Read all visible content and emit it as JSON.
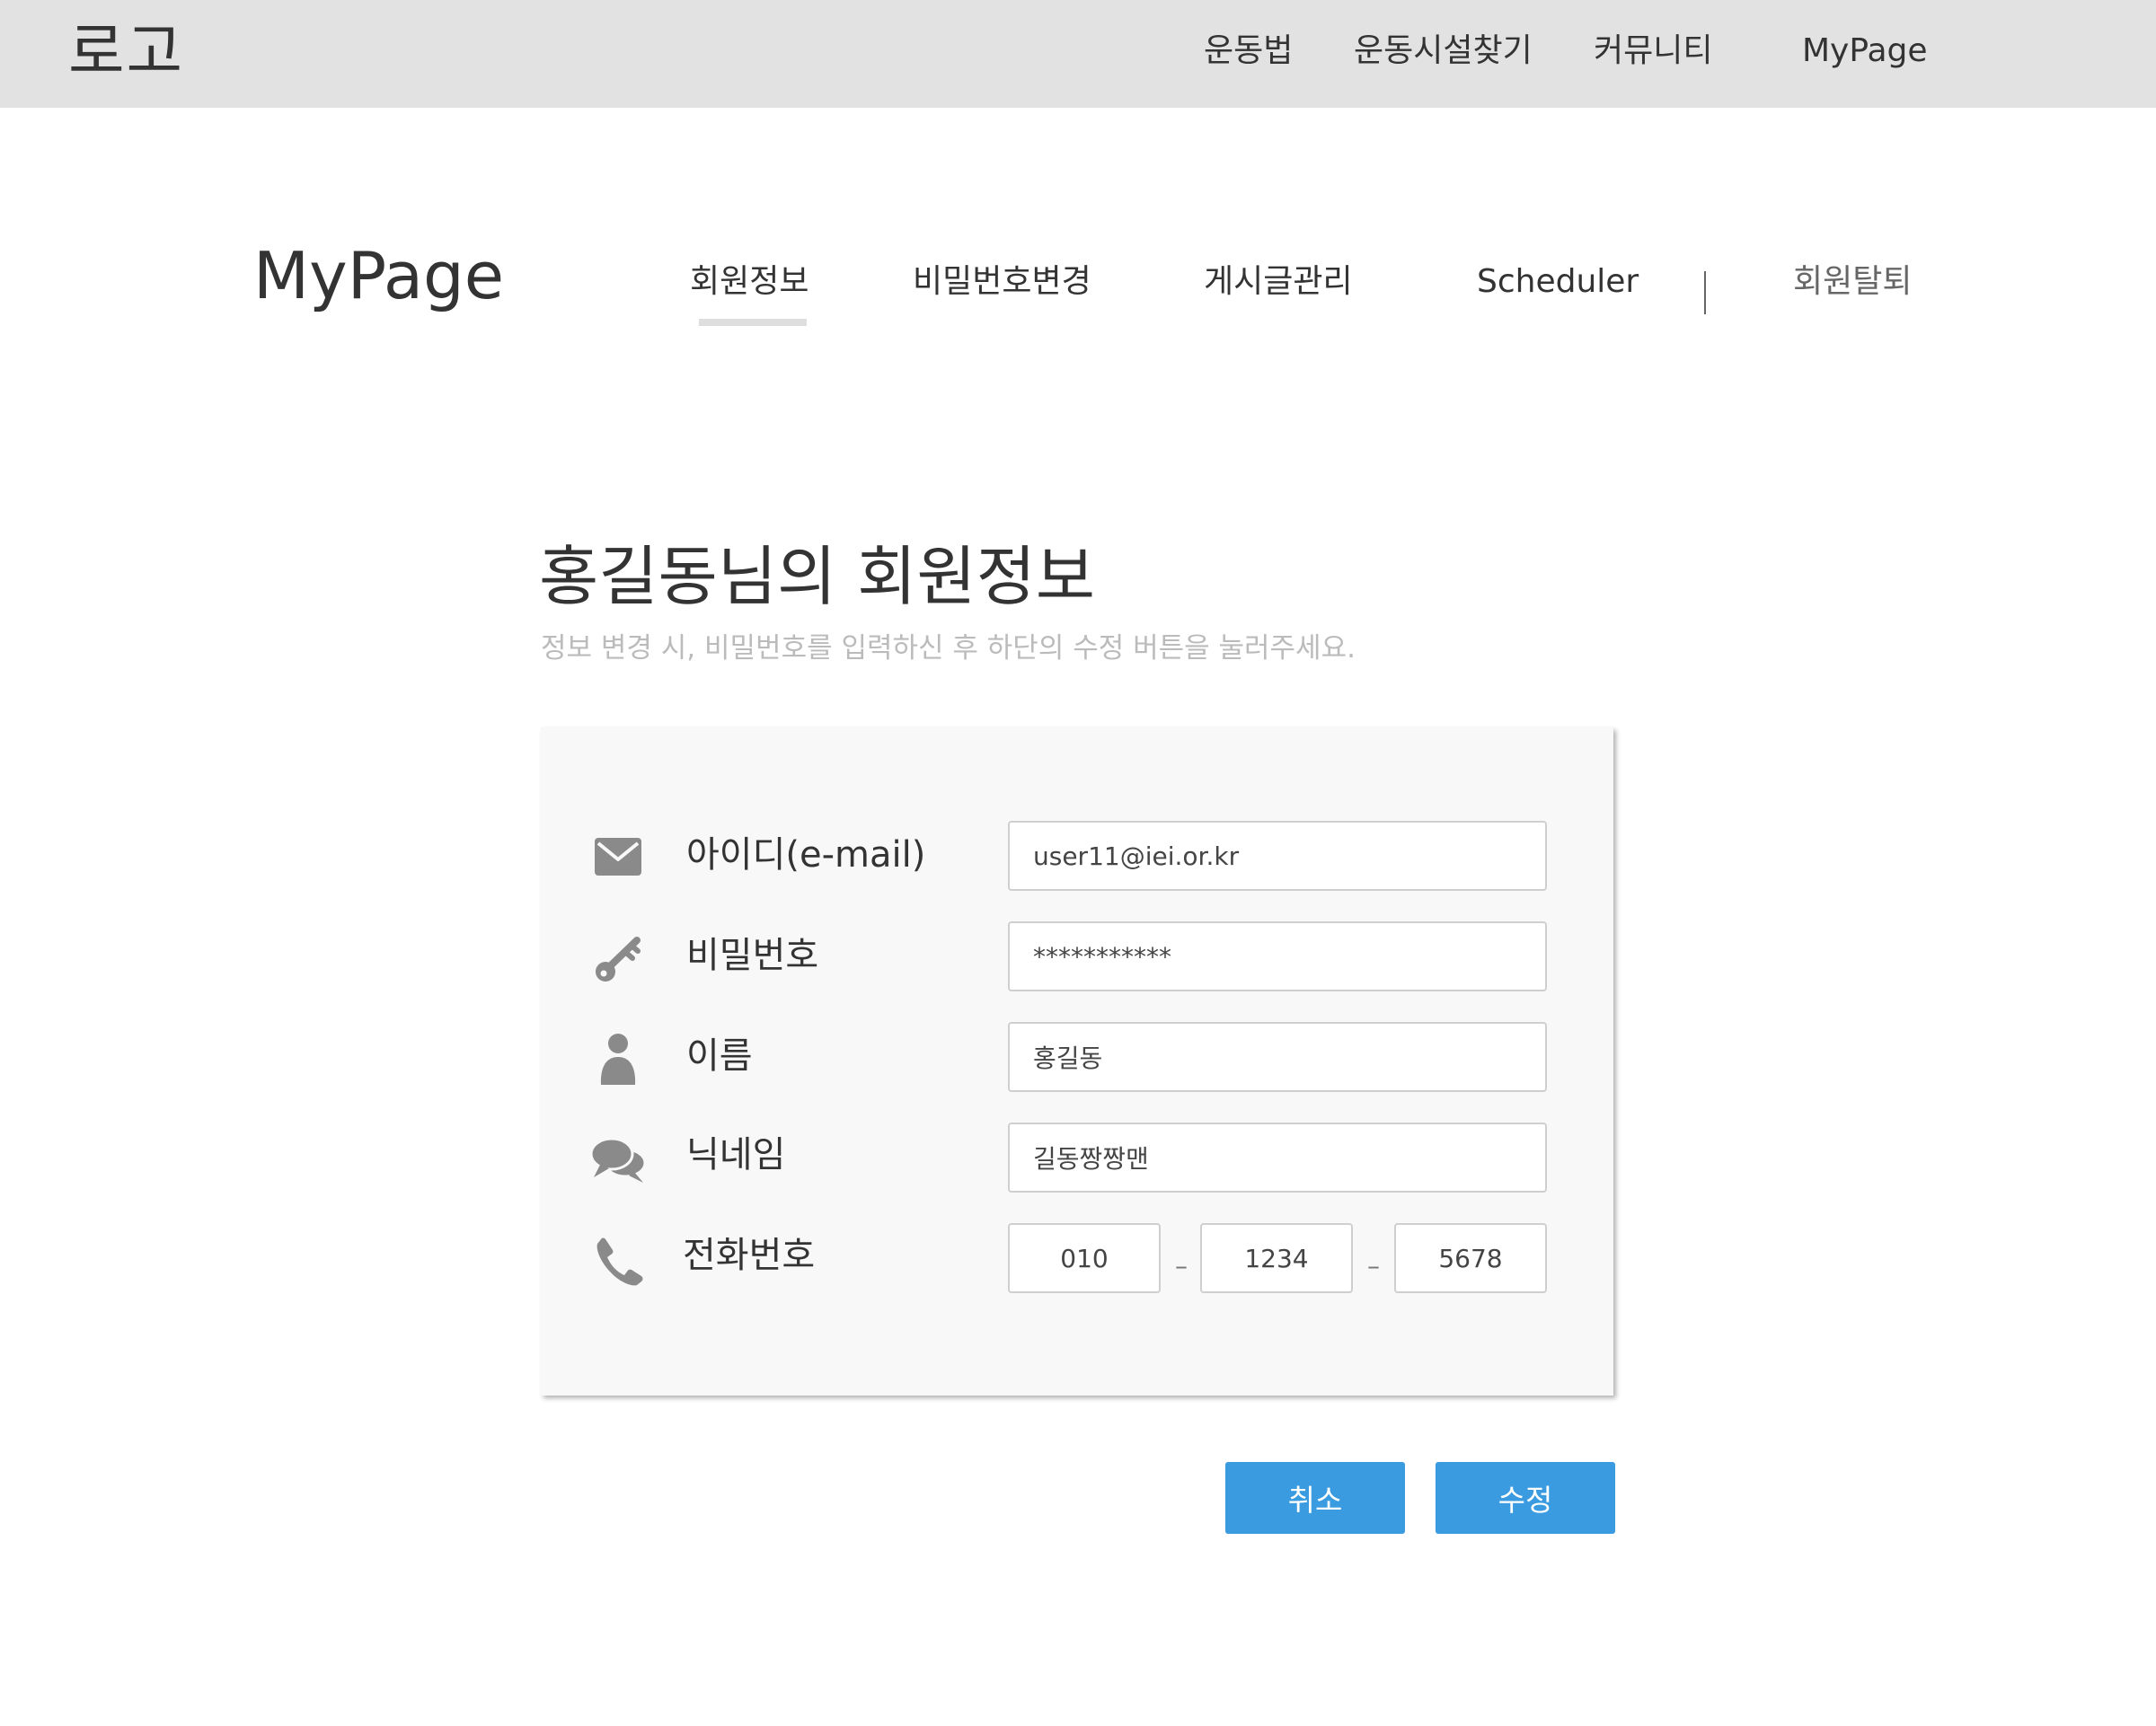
{
  "header": {
    "logo": "로고",
    "nav": [
      {
        "label": "운동법"
      },
      {
        "label": "운동시설찾기"
      },
      {
        "label": "커뮤니티"
      },
      {
        "label": "MyPage"
      }
    ]
  },
  "mypage": {
    "title": "MyPage",
    "tabs": [
      {
        "label": "회원정보",
        "active": true
      },
      {
        "label": "비밀번호변경"
      },
      {
        "label": "게시글관리"
      },
      {
        "label": "Scheduler"
      },
      {
        "label": "회원탈퇴"
      }
    ]
  },
  "content": {
    "heading": "홍길동님의 회원정보",
    "subheading": "정보 변경 시, 비밀번호를 입력하신 후 하단의 수정 버튼을 눌러주세요."
  },
  "form": {
    "email": {
      "label": "아이디(e-mail)",
      "value": "user11@iei.or.kr",
      "icon": "envelope-icon"
    },
    "password": {
      "label": "비밀번호",
      "value": "***********",
      "icon": "key-icon"
    },
    "name": {
      "label": "이름",
      "value": "홍길동",
      "icon": "person-icon"
    },
    "nickname": {
      "label": "닉네임",
      "value": "길동짱짱맨",
      "icon": "chat-bubbles-icon"
    },
    "phone": {
      "label": "전화번호",
      "part1": "010",
      "separator": "–",
      "part2": "1234",
      "part3": "5678",
      "icon": "phone-icon"
    }
  },
  "buttons": {
    "cancel": "취소",
    "submit": "수정"
  },
  "colors": {
    "topbar_bg": "#e2e2e2",
    "card_bg": "#f8f8f8",
    "button_blue": "#3a9be0",
    "icon_gray": "#8a8a8a",
    "subtext_gray": "#bbbbbb"
  }
}
